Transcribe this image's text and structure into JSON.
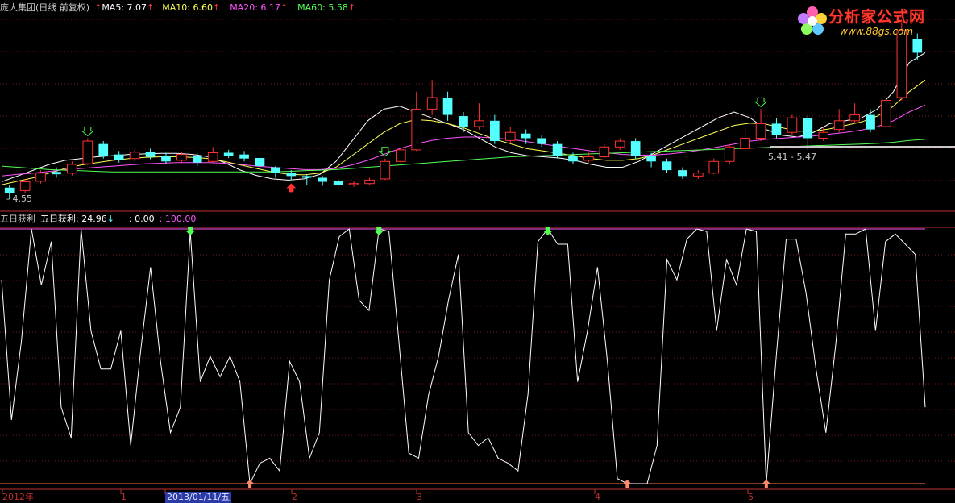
{
  "main_header": {
    "title": "庞大集团(日线 前复权)",
    "ma5_label": "MA5: 7.07",
    "ma10_label": "MA10: 6.60",
    "ma20_label": "MA20: 6.17",
    "ma60_label": "MA60: 5.58",
    "up_arrow": "↑"
  },
  "sub_header": {
    "name": "五日获利",
    "value_label": "五日获利: 24.96",
    "down_arrow": "↓",
    "zero_label": ": 0.00",
    "hundred_label": ": 100.00"
  },
  "annotations": {
    "low_price": "4.55",
    "range_label": "5.41 - 5.47"
  },
  "logo": {
    "name": "分析家公式网",
    "url": "www.88gs.com"
  },
  "x_axis": {
    "labels": [
      "2012年",
      "1",
      "2013/01/11/五",
      "2",
      "3",
      "4",
      "5"
    ]
  },
  "colors": {
    "up": "#ff3232",
    "down": "#54ffff",
    "ma5": "#ffffff",
    "ma10": "#ffff54",
    "ma20": "#ff54ff",
    "ma60": "#54ff54",
    "grid": "#7a1a1a",
    "axis": "#c03030",
    "oscillator": "#ffffff",
    "line100": "#ff54ff",
    "line0": "#ff8040"
  },
  "chart_data": [
    {
      "type": "candlestick",
      "title": "庞大集团(日线 前复权)",
      "series": [
        {
          "name": "MA5",
          "values": [
            4.85,
            4.95,
            5.05,
            5.15,
            5.22,
            5.25,
            5.28,
            5.3,
            5.32,
            5.33,
            5.34,
            5.34,
            5.32,
            5.28,
            5.18,
            5.05,
            4.96,
            4.9,
            4.88,
            4.9,
            4.98,
            5.2,
            5.55,
            5.9,
            6.1,
            6.15,
            6.05,
            5.95,
            5.85,
            5.75,
            5.6,
            5.45,
            5.35,
            5.3,
            5.28,
            5.26,
            5.22,
            5.15,
            5.1,
            5.1,
            5.2,
            5.35,
            5.5,
            5.65,
            5.8,
            5.95,
            6.05,
            5.95,
            5.75,
            5.65,
            5.62,
            5.7,
            5.85,
            5.9,
            5.95,
            6.1,
            6.4,
            6.9,
            7.07
          ]
        },
        {
          "name": "MA10",
          "values": [
            4.8,
            4.86,
            4.92,
            5.0,
            5.08,
            5.14,
            5.18,
            5.22,
            5.25,
            5.27,
            5.28,
            5.28,
            5.27,
            5.25,
            5.2,
            5.14,
            5.08,
            5.02,
            4.98,
            4.97,
            5.0,
            5.1,
            5.3,
            5.5,
            5.7,
            5.85,
            5.92,
            5.9,
            5.85,
            5.78,
            5.68,
            5.58,
            5.5,
            5.42,
            5.38,
            5.34,
            5.3,
            5.25,
            5.22,
            5.22,
            5.25,
            5.32,
            5.42,
            5.52,
            5.62,
            5.72,
            5.82,
            5.86,
            5.84,
            5.78,
            5.72,
            5.72,
            5.76,
            5.82,
            5.88,
            5.98,
            6.15,
            6.4,
            6.6
          ]
        },
        {
          "name": "MA20",
          "values": [
            4.95,
            4.98,
            5.0,
            5.03,
            5.06,
            5.08,
            5.1,
            5.12,
            5.14,
            5.16,
            5.17,
            5.18,
            5.18,
            5.18,
            5.17,
            5.15,
            5.12,
            5.1,
            5.08,
            5.06,
            5.06,
            5.08,
            5.14,
            5.22,
            5.32,
            5.42,
            5.5,
            5.56,
            5.6,
            5.62,
            5.62,
            5.6,
            5.58,
            5.54,
            5.5,
            5.46,
            5.42,
            5.38,
            5.35,
            5.32,
            5.31,
            5.31,
            5.33,
            5.36,
            5.4,
            5.45,
            5.5,
            5.55,
            5.58,
            5.6,
            5.62,
            5.64,
            5.67,
            5.7,
            5.74,
            5.8,
            5.9,
            6.05,
            6.17
          ]
        },
        {
          "name": "MA60",
          "values": [
            5.12,
            5.1,
            5.08,
            5.06,
            5.05,
            5.04,
            5.03,
            5.02,
            5.02,
            5.02,
            5.02,
            5.02,
            5.02,
            5.02,
            5.02,
            5.02,
            5.02,
            5.02,
            5.03,
            5.04,
            5.05,
            5.06,
            5.08,
            5.1,
            5.12,
            5.14,
            5.16,
            5.18,
            5.2,
            5.22,
            5.24,
            5.26,
            5.28,
            5.29,
            5.3,
            5.31,
            5.32,
            5.33,
            5.34,
            5.35,
            5.36,
            5.37,
            5.38,
            5.39,
            5.4,
            5.41,
            5.42,
            5.43,
            5.44,
            5.45,
            5.46,
            5.47,
            5.48,
            5.49,
            5.5,
            5.51,
            5.53,
            5.56,
            5.58
          ]
        }
      ],
      "candles": [
        {
          "o": 4.75,
          "c": 4.65,
          "h": 4.8,
          "l": 4.55
        },
        {
          "o": 4.7,
          "c": 4.85,
          "h": 4.9,
          "l": 4.66
        },
        {
          "o": 4.86,
          "c": 5.0,
          "h": 5.05,
          "l": 4.82
        },
        {
          "o": 5.02,
          "c": 4.98,
          "h": 5.1,
          "l": 4.92
        },
        {
          "o": 5.0,
          "c": 5.15,
          "h": 5.2,
          "l": 4.96
        },
        {
          "o": 5.16,
          "c": 5.55,
          "h": 5.6,
          "l": 5.14
        },
        {
          "o": 5.5,
          "c": 5.3,
          "h": 5.55,
          "l": 5.25
        },
        {
          "o": 5.32,
          "c": 5.22,
          "h": 5.38,
          "l": 5.18
        },
        {
          "o": 5.25,
          "c": 5.36,
          "h": 5.4,
          "l": 5.2
        },
        {
          "o": 5.36,
          "c": 5.28,
          "h": 5.42,
          "l": 5.24
        },
        {
          "o": 5.3,
          "c": 5.2,
          "h": 5.35,
          "l": 5.15
        },
        {
          "o": 5.22,
          "c": 5.32,
          "h": 5.36,
          "l": 5.18
        },
        {
          "o": 5.3,
          "c": 5.18,
          "h": 5.34,
          "l": 5.12
        },
        {
          "o": 5.2,
          "c": 5.35,
          "h": 5.45,
          "l": 5.18
        },
        {
          "o": 5.35,
          "c": 5.3,
          "h": 5.4,
          "l": 5.26
        },
        {
          "o": 5.32,
          "c": 5.25,
          "h": 5.38,
          "l": 5.2
        },
        {
          "o": 5.26,
          "c": 5.12,
          "h": 5.3,
          "l": 5.05
        },
        {
          "o": 5.1,
          "c": 5.0,
          "h": 5.12,
          "l": 4.92
        },
        {
          "o": 5.0,
          "c": 4.95,
          "h": 5.05,
          "l": 4.88
        },
        {
          "o": 4.95,
          "c": 4.92,
          "h": 4.98,
          "l": 4.8
        },
        {
          "o": 4.92,
          "c": 4.85,
          "h": 4.95,
          "l": 4.78
        },
        {
          "o": 4.86,
          "c": 4.8,
          "h": 4.9,
          "l": 4.74
        },
        {
          "o": 4.8,
          "c": 4.82,
          "h": 4.86,
          "l": 4.76
        },
        {
          "o": 4.82,
          "c": 4.88,
          "h": 4.92,
          "l": 4.8
        },
        {
          "o": 4.9,
          "c": 5.2,
          "h": 5.25,
          "l": 4.88
        },
        {
          "o": 5.2,
          "c": 5.4,
          "h": 5.45,
          "l": 5.15
        },
        {
          "o": 5.4,
          "c": 6.1,
          "h": 6.4,
          "l": 5.38
        },
        {
          "o": 6.1,
          "c": 6.3,
          "h": 6.6,
          "l": 6.0
        },
        {
          "o": 6.3,
          "c": 6.0,
          "h": 6.4,
          "l": 5.9
        },
        {
          "o": 5.98,
          "c": 5.8,
          "h": 6.05,
          "l": 5.7
        },
        {
          "o": 5.8,
          "c": 5.9,
          "h": 6.2,
          "l": 5.75
        },
        {
          "o": 5.9,
          "c": 5.55,
          "h": 6.0,
          "l": 5.5
        },
        {
          "o": 5.56,
          "c": 5.7,
          "h": 5.8,
          "l": 5.5
        },
        {
          "o": 5.68,
          "c": 5.6,
          "h": 5.75,
          "l": 5.5
        },
        {
          "o": 5.6,
          "c": 5.5,
          "h": 5.65,
          "l": 5.45
        },
        {
          "o": 5.5,
          "c": 5.3,
          "h": 5.55,
          "l": 5.25
        },
        {
          "o": 5.3,
          "c": 5.2,
          "h": 5.35,
          "l": 5.15
        },
        {
          "o": 5.22,
          "c": 5.28,
          "h": 5.35,
          "l": 5.18
        },
        {
          "o": 5.28,
          "c": 5.45,
          "h": 5.5,
          "l": 5.25
        },
        {
          "o": 5.45,
          "c": 5.55,
          "h": 5.6,
          "l": 5.4
        },
        {
          "o": 5.55,
          "c": 5.3,
          "h": 5.6,
          "l": 5.25
        },
        {
          "o": 5.3,
          "c": 5.2,
          "h": 5.35,
          "l": 5.1
        },
        {
          "o": 5.2,
          "c": 5.05,
          "h": 5.25,
          "l": 5.0
        },
        {
          "o": 5.05,
          "c": 4.95,
          "h": 5.1,
          "l": 4.9
        },
        {
          "o": 4.95,
          "c": 5.0,
          "h": 5.05,
          "l": 4.9
        },
        {
          "o": 5.0,
          "c": 5.2,
          "h": 5.25,
          "l": 4.98
        },
        {
          "o": 5.2,
          "c": 5.45,
          "h": 5.5,
          "l": 5.15
        },
        {
          "o": 5.42,
          "c": 5.6,
          "h": 5.8,
          "l": 5.4
        },
        {
          "o": 5.6,
          "c": 5.85,
          "h": 6.1,
          "l": 5.55
        },
        {
          "o": 5.85,
          "c": 5.65,
          "h": 5.95,
          "l": 5.6
        },
        {
          "o": 5.7,
          "c": 5.95,
          "h": 6.0,
          "l": 5.65
        },
        {
          "o": 5.95,
          "c": 5.6,
          "h": 6.0,
          "l": 5.4
        },
        {
          "o": 5.6,
          "c": 5.7,
          "h": 5.8,
          "l": 5.55
        },
        {
          "o": 5.75,
          "c": 5.9,
          "h": 6.1,
          "l": 5.7
        },
        {
          "o": 5.9,
          "c": 6.0,
          "h": 6.2,
          "l": 5.85
        },
        {
          "o": 6.0,
          "c": 5.75,
          "h": 6.1,
          "l": 5.7
        },
        {
          "o": 5.8,
          "c": 6.25,
          "h": 6.5,
          "l": 5.78
        },
        {
          "o": 6.3,
          "c": 7.45,
          "h": 7.6,
          "l": 6.25
        },
        {
          "o": 7.3,
          "c": 7.07,
          "h": 7.4,
          "l": 6.95
        }
      ],
      "signals_down": [
        5,
        24,
        48
      ],
      "signals_up": [
        18
      ],
      "annotations": [
        "4.55",
        "5.41 - 5.47"
      ]
    },
    {
      "type": "line",
      "title": "五日获利",
      "ylim": [
        0,
        100
      ],
      "series": [
        {
          "name": "五日获利",
          "values": [
            80,
            25,
            56,
            100,
            78,
            95,
            30,
            18,
            100,
            60,
            45,
            45,
            60,
            15,
            52,
            85,
            48,
            20,
            30,
            99,
            40,
            50,
            42,
            50,
            40,
            0,
            8,
            10,
            5,
            48,
            40,
            10,
            20,
            80,
            97,
            100,
            72,
            68,
            100,
            99,
            56,
            12,
            10,
            35,
            50,
            72,
            90,
            20,
            15,
            18,
            10,
            8,
            5,
            35,
            95,
            100,
            94,
            94,
            40,
            60,
            85,
            48,
            2,
            0,
            0,
            0,
            15,
            88,
            80,
            96,
            100,
            99,
            60,
            88,
            78,
            100,
            99,
            0,
            50,
            96,
            96,
            75,
            45,
            20,
            55,
            98,
            98,
            100,
            60,
            95,
            98,
            94,
            90,
            30
          ]
        }
      ],
      "signals_down": [
        19,
        38,
        55
      ],
      "signals_up": [
        25,
        63,
        77
      ]
    }
  ]
}
